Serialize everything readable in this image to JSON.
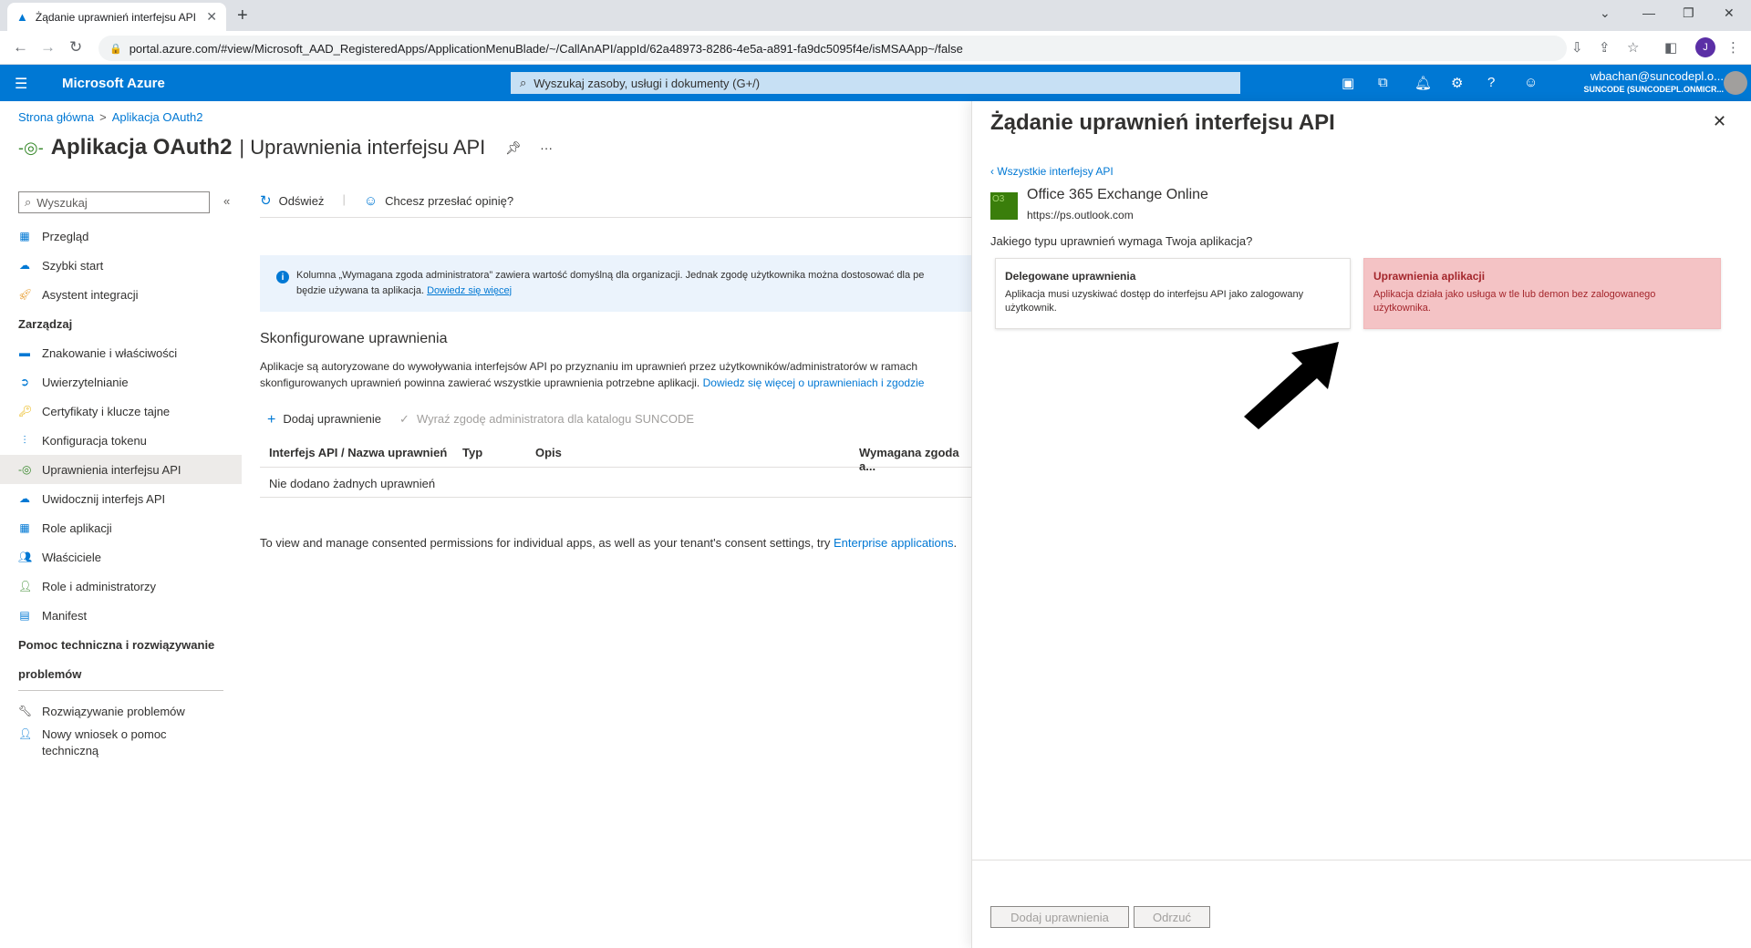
{
  "browser": {
    "tab_title": "Żądanie uprawnień interfejsu API",
    "url": "portal.azure.com/#view/Microsoft_AAD_RegisteredApps/ApplicationMenuBlade/~/CallAnAPI/appId/62a48973-8286-4e5a-a891-fa9dc5095f4e/isMSAApp~/false",
    "profile_initial": "J"
  },
  "header": {
    "brand": "Microsoft Azure",
    "search_placeholder": "Wyszukaj zasoby, usługi i dokumenty (G+/)",
    "user_email": "wbachan@suncodepl.o...",
    "user_tenant": "SUNCODE (SUNCODEPL.ONMICR..."
  },
  "breadcrumb": {
    "home": "Strona główna",
    "sep": ">",
    "app": "Aplikacja OAuth2"
  },
  "page": {
    "title_app": "Aplikacja OAuth2",
    "title_section": "| Uprawnienia interfejsu API"
  },
  "sidebar": {
    "search_placeholder": "Wyszukaj",
    "items": [
      {
        "label": "Przegląd"
      },
      {
        "label": "Szybki start"
      },
      {
        "label": "Asystent integracji"
      }
    ],
    "section_manage": "Zarządzaj",
    "manage_items": [
      {
        "label": "Znakowanie i właściwości"
      },
      {
        "label": "Uwierzytelnianie"
      },
      {
        "label": "Certyfikaty i klucze tajne"
      },
      {
        "label": "Konfiguracja tokenu"
      },
      {
        "label": "Uprawnienia interfejsu API"
      },
      {
        "label": "Uwidocznij interfejs API"
      },
      {
        "label": "Role aplikacji"
      },
      {
        "label": "Właściciele"
      },
      {
        "label": "Role i administratorzy"
      },
      {
        "label": "Manifest"
      }
    ],
    "section_support_1": "Pomoc techniczna i rozwiązywanie",
    "section_support_2": "problemów",
    "support_items": [
      {
        "label": "Rozwiązywanie problemów"
      },
      {
        "label": "Nowy wniosek o pomoc"
      },
      {
        "label": "techniczną"
      }
    ]
  },
  "toolbar": {
    "refresh": "Odśwież",
    "feedback": "Chcesz przesłać opinię?"
  },
  "info": {
    "line1": "Kolumna „Wymagana zgoda administratora” zawiera wartość domyślną dla organizacji. Jednak zgodę użytkownika można dostosować dla pe",
    "line2": "będzie używana ta aplikacja.",
    "link": "Dowiedz się więcej"
  },
  "configured": {
    "title": "Skonfigurowane uprawnienia",
    "desc1": "Aplikacje są autoryzowane do wywoływania interfejsów API po przyznaniu im uprawnień przez użytkowników/administratorów w ramach",
    "desc2": "skonfigurowanych uprawnień powinna zawierać wszystkie uprawnienia potrzebne aplikacji.",
    "desc_link": "Dowiedz się więcej o uprawnieniach i zgodzie",
    "add_permission": "Dodaj uprawnienie",
    "grant_consent": "Wyraź zgodę administratora dla katalogu SUNCODE",
    "col_api": "Interfejs API / Nazwa uprawnień",
    "col_type": "Typ",
    "col_desc": "Opis",
    "col_admin": "Wymagana zgoda a...",
    "empty_row": "Nie dodano żadnych uprawnień",
    "footnote": "To view and manage consented permissions for individual apps, as well as your tenant's consent settings, try",
    "footnote_link": "Enterprise applications",
    "footnote_end": "."
  },
  "panel": {
    "title": "Żądanie uprawnień interfejsu API",
    "back": "Wszystkie interfejsy API",
    "api_icon_text": "O3",
    "api_name": "Office 365 Exchange Online",
    "api_url": "https://ps.outlook.com",
    "question": "Jakiego typu uprawnień wymaga Twoja aplikacja?",
    "delegated_title": "Delegowane uprawnienia",
    "delegated_desc": "Aplikacja musi uzyskiwać dostęp do interfejsu API jako zalogowany użytkownik.",
    "app_title": "Uprawnienia aplikacji",
    "app_desc": "Aplikacja działa jako usługa w tle lub demon bez zalogowanego użytkownika.",
    "add_button": "Dodaj uprawnienia",
    "discard_button": "Odrzuć"
  }
}
